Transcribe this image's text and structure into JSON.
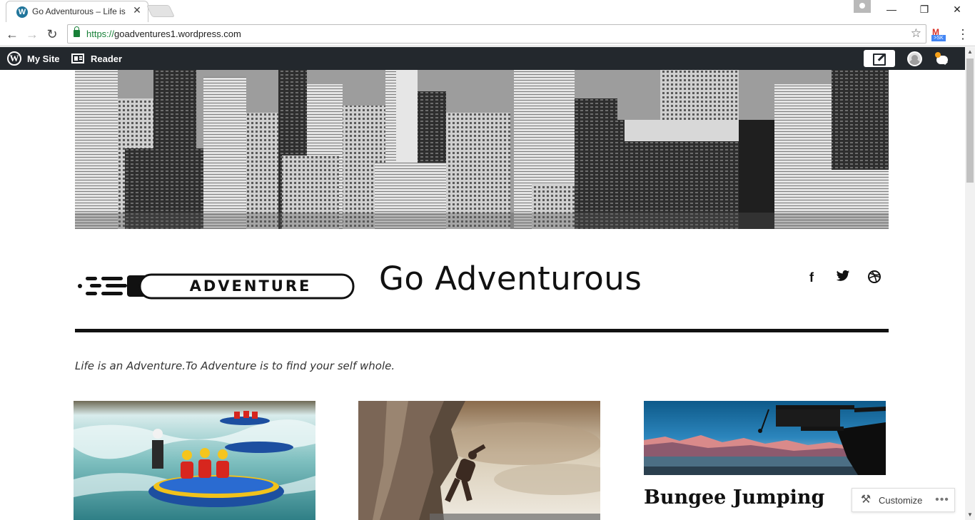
{
  "browser": {
    "tab_title": "Go Adventurous – Life is",
    "url_scheme": "https://",
    "url_host": "goadventures1.wordpress.com",
    "extension_badge": ">SK"
  },
  "adminbar": {
    "my_site": "My Site",
    "reader": "Reader"
  },
  "site": {
    "logo_text": "ADVENTURE",
    "title": "Go Adventurous",
    "tagline": "Life is an Adventure.To Adventure is to find your self whole."
  },
  "social": [
    "facebook-icon",
    "twitter-icon",
    "dribbble-icon"
  ],
  "posts": [
    {
      "image": "white-water-rafting"
    },
    {
      "image": "rock-climbing"
    },
    {
      "image": "bungee-jumping",
      "title": "Bungee Jumping"
    }
  ],
  "customize": {
    "label": "Customize"
  },
  "colors": {
    "adminbar_bg": "#23282d",
    "text": "#111111",
    "wp_blue": "#21759b",
    "notification": "#f6a018"
  }
}
